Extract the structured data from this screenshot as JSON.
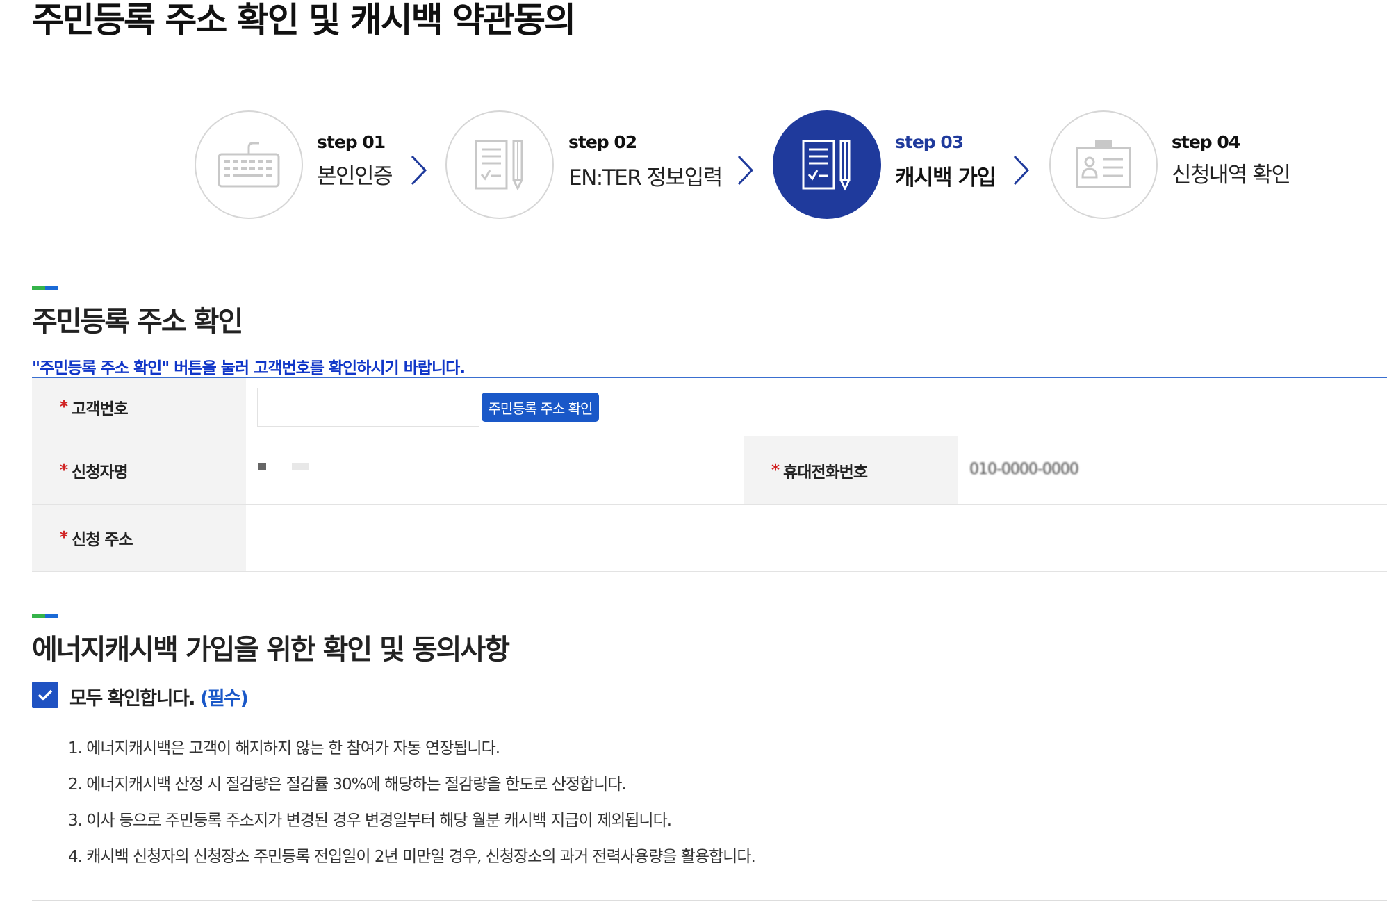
{
  "page_title": "주민등록 주소 확인 및 캐시백 약관동의",
  "steps": [
    {
      "num": "step 01",
      "label": "본인인증",
      "icon": "keyboard-icon",
      "active": false
    },
    {
      "num": "step 02",
      "label": "EN:TER 정보입력",
      "icon": "checklist-pencil-icon",
      "active": false
    },
    {
      "num": "step 03",
      "label": "캐시백 가입",
      "icon": "checklist-pencil-icon",
      "active": true
    },
    {
      "num": "step 04",
      "label": "신청내역 확인",
      "icon": "id-card-icon",
      "active": false
    }
  ],
  "colors": {
    "active_step": "#1f3a9c",
    "accent_blue": "#1a58c8",
    "notice_blue": "#1036c8",
    "required_red": "#d02020",
    "bar_green": "#35b34a",
    "bar_blue": "#1a6ad6"
  },
  "address_section": {
    "title": "주민등록 주소 확인",
    "notice": "\"주민등록 주소 확인\" 버튼을 눌러 고객번호를 확인하시기 바랍니다.",
    "required_mark": "*",
    "customer_number_label": "고객번호",
    "customer_number_value": "",
    "verify_button": "주민등록 주소 확인",
    "applicant_name_label": "신청자명",
    "phone_label": "휴대전화번호",
    "phone_value": "010-0000-0000",
    "address_label": "신청 주소"
  },
  "agreement_section": {
    "title": "에너지캐시백 가입을 위한 확인 및 동의사항",
    "check_all_label": "모두 확인합니다.",
    "check_all_required": "(필수)",
    "checked": true,
    "terms": [
      "1. 에너지캐시백은 고객이 해지하지 않는 한 참여가 자동 연장됩니다.",
      "2. 에너지캐시백 산정 시 절감량은 절감률 30%에 해당하는 절감량을 한도로 산정합니다.",
      "3. 이사 등으로 주민등록 주소지가 변경된 경우 변경일부터 해당 월분 캐시백 지급이 제외됩니다.",
      "4. 캐시백 신청자의 신청장소 주민등록 전입일이 2년 미만일 경우, 신청장소의 과거 전력사용량을 활용합니다."
    ]
  }
}
